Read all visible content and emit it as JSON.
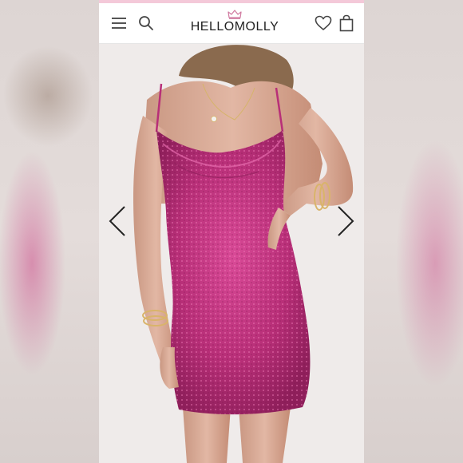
{
  "header": {
    "brand": "HELLOMOLLY",
    "icons": {
      "menu": "menu-icon",
      "search": "search-icon",
      "crown": "crown-icon",
      "wishlist": "heart-icon",
      "bag": "shopping-bag-icon"
    }
  },
  "gallery": {
    "image": "product-photo-pink-sequin-mini-dress",
    "prev": "chevron-left-icon",
    "next": "chevron-right-icon"
  },
  "colors": {
    "accent_bar": "#f4c9d9",
    "crown": "#d07aa0",
    "dress": "#c2337f",
    "icon": "#444444"
  }
}
